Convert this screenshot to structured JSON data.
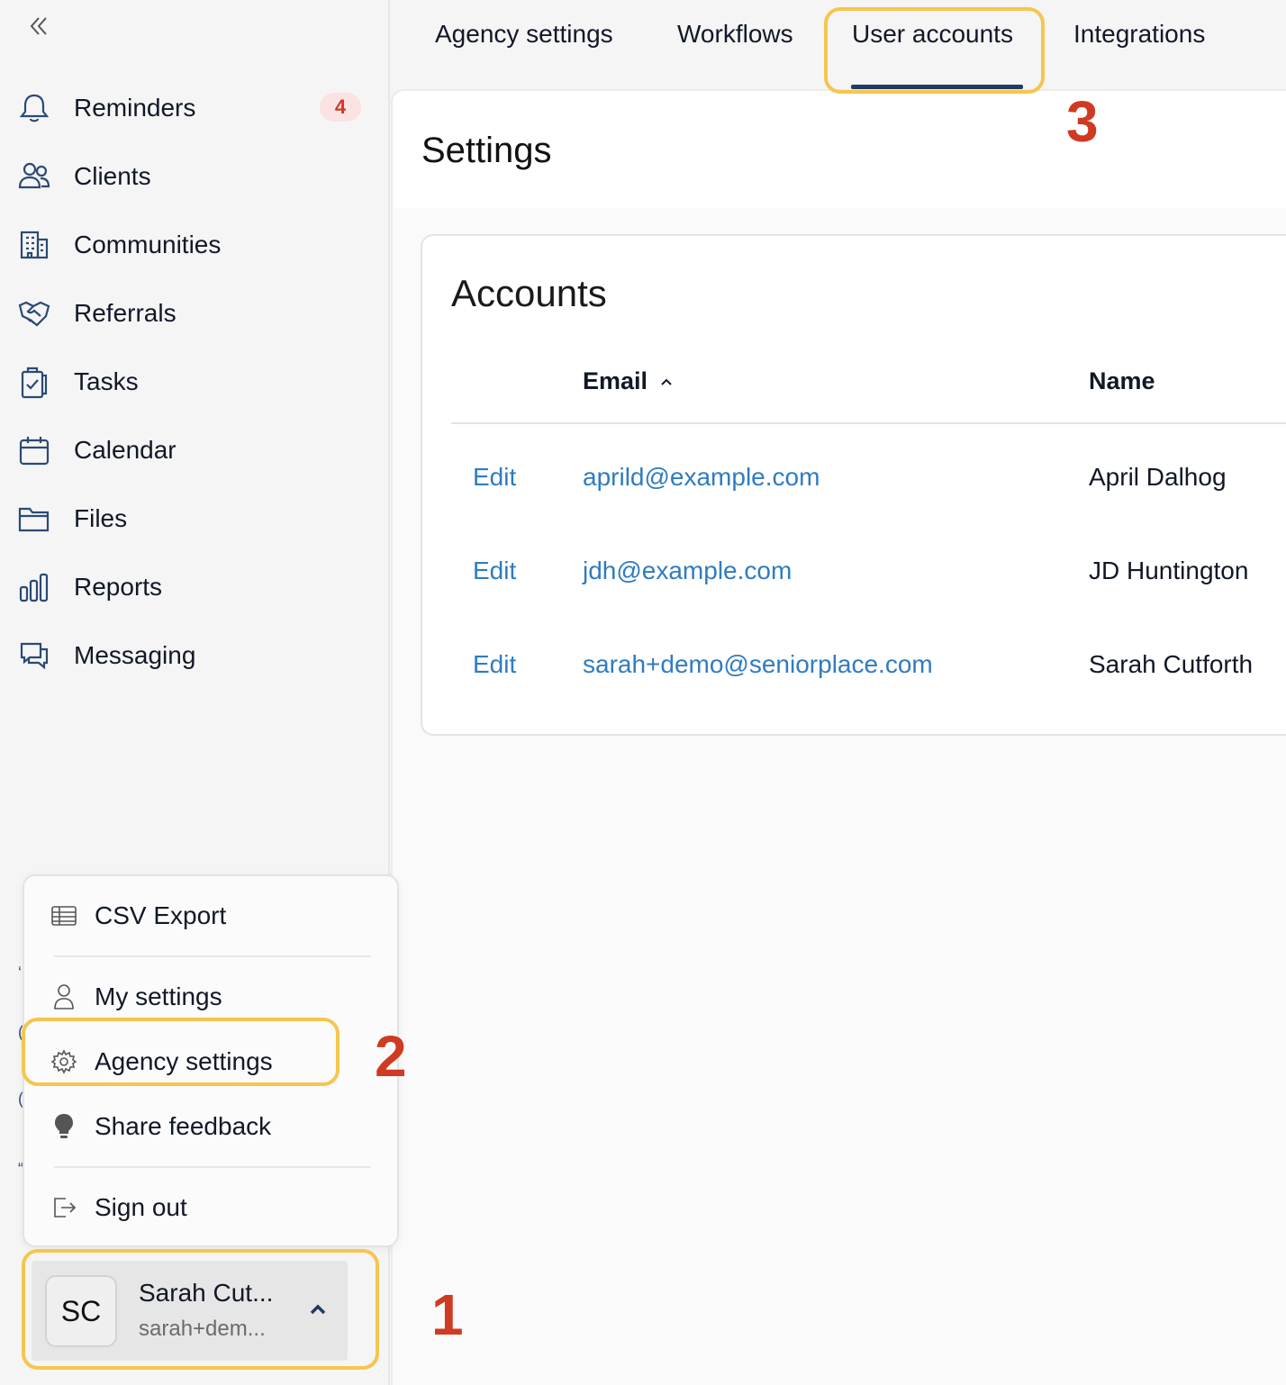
{
  "sidebar": {
    "items": [
      {
        "label": "Reminders",
        "icon": "bell-icon",
        "badge": "4"
      },
      {
        "label": "Clients",
        "icon": "users-icon"
      },
      {
        "label": "Communities",
        "icon": "building-icon"
      },
      {
        "label": "Referrals",
        "icon": "handshake-icon"
      },
      {
        "label": "Tasks",
        "icon": "clipboard-check-icon"
      },
      {
        "label": "Calendar",
        "icon": "calendar-icon"
      },
      {
        "label": "Files",
        "icon": "folder-icon"
      },
      {
        "label": "Reports",
        "icon": "bar-chart-icon"
      },
      {
        "label": "Messaging",
        "icon": "chat-icon"
      }
    ]
  },
  "tabs": [
    "Agency settings",
    "Workflows",
    "User accounts",
    "Integrations"
  ],
  "active_tab": "User accounts",
  "page": {
    "title": "Settings"
  },
  "accounts": {
    "title": "Accounts",
    "columns": {
      "email": "Email",
      "name": "Name"
    },
    "sort_icon": "chevron-up-icon",
    "rows": [
      {
        "action": "Edit",
        "email": "aprild@example.com",
        "name": "April Dalhog"
      },
      {
        "action": "Edit",
        "email": "jdh@example.com",
        "name": "JD Huntington"
      },
      {
        "action": "Edit",
        "email": "sarah+demo@seniorplace.com",
        "name": "Sarah Cutforth"
      }
    ]
  },
  "menu": {
    "items": [
      {
        "label": "CSV Export",
        "icon": "table-icon"
      },
      {
        "label": "My settings",
        "icon": "user-icon"
      },
      {
        "label": "Agency settings",
        "icon": "gear-icon"
      },
      {
        "label": "Share feedback",
        "icon": "lightbulb-icon"
      },
      {
        "label": "Sign out",
        "icon": "sign-out-icon"
      }
    ]
  },
  "profile": {
    "initials": "SC",
    "name": "Sarah Cut...",
    "email": "sarah+dem..."
  },
  "steps": [
    "1",
    "2",
    "3"
  ],
  "colors": {
    "highlight": "#f5c64f",
    "step_number": "#cf3a22",
    "link": "#2f7cc0",
    "badge_bg": "#fbe3e3",
    "badge_text": "#d4372b",
    "tab_underline": "#1f3b66"
  }
}
